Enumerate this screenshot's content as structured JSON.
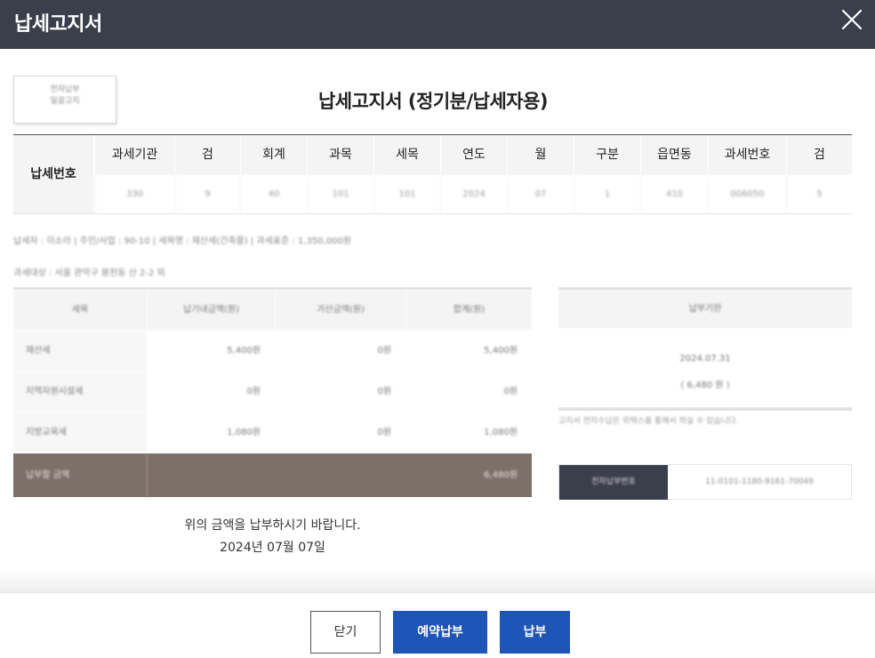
{
  "window": {
    "title": "납세고지서",
    "close_icon": "close-icon"
  },
  "stamp": {
    "line1": "전자납부",
    "line2": "일괄고지"
  },
  "document": {
    "title": "납세고지서 (정기분/납세자용)"
  },
  "tax_number": {
    "label": "납세번호",
    "headers": [
      "과세기관",
      "검",
      "회계",
      "과목",
      "세목",
      "연도",
      "월",
      "구분",
      "읍면동",
      "과세번호",
      "검"
    ],
    "values": [
      "330",
      "9",
      "40",
      "101",
      "101",
      "2024",
      "07",
      "1",
      "410",
      "006050",
      "5"
    ]
  },
  "meta": {
    "line1": "납세자 : 이소라  |  주민/사업 : 90-10  |  세목명 : 재산세(건축물)  |  과세표준 : 1,350,000원",
    "line2": "과세대상 : 서울 관악구 봉천동 산 2-2 외"
  },
  "amount_table": {
    "headers": [
      "세목",
      "납기내금액(원)",
      "가산금액(원)",
      "합계(원)"
    ],
    "rows": [
      {
        "name": "재산세",
        "due": "5,400원",
        "extra": "0원",
        "total": "5,400원"
      },
      {
        "name": "지역자원시설세",
        "due": "0원",
        "extra": "0원",
        "total": "0원"
      },
      {
        "name": "지방교육세",
        "due": "1,080원",
        "extra": "0원",
        "total": "1,080원"
      }
    ],
    "total_label": "납부할 금액",
    "total_value": "6,480원"
  },
  "side": {
    "header": "납부기한",
    "date": "2024.07.31",
    "amount": "( 6,480 원 )",
    "note": "고지서 전자수납은 위택스를 통해서 하실 수 있습니다."
  },
  "account": {
    "label": "전자납부번호",
    "value": "11-0101-1180-9161-70049"
  },
  "notice": {
    "message": "위의 금액을 납부하시기 바랍니다.",
    "date": "2024년 07월 07일"
  },
  "buttons": {
    "close": "닫기",
    "reserve": "예약납부",
    "pay": "납부"
  },
  "colors": {
    "titlebar": "#3b3e4b",
    "primary": "#1f55b6",
    "total_row": "#7d7069"
  }
}
